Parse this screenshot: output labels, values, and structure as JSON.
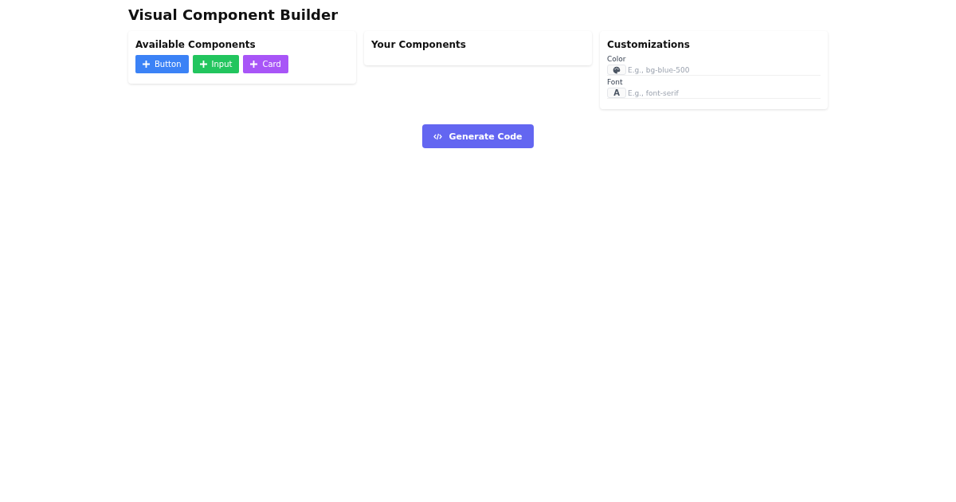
{
  "title": "Visual Component Builder",
  "available": {
    "heading": "Available Components",
    "buttons": [
      {
        "label": "Button",
        "color": "#3b82f6"
      },
      {
        "label": "Input",
        "color": "#22c55e"
      },
      {
        "label": "Card",
        "color": "#a855f7"
      }
    ]
  },
  "yours": {
    "heading": "Your Components"
  },
  "customizations": {
    "heading": "Customizations",
    "fields": [
      {
        "label": "Color",
        "kind": "palette",
        "placeholder": "E.g., bg-blue-500"
      },
      {
        "label": "Font",
        "kind": "letter",
        "prefix": "A",
        "placeholder": "E.g., font-serif"
      }
    ]
  },
  "generate_button": {
    "label": "Generate Code"
  }
}
